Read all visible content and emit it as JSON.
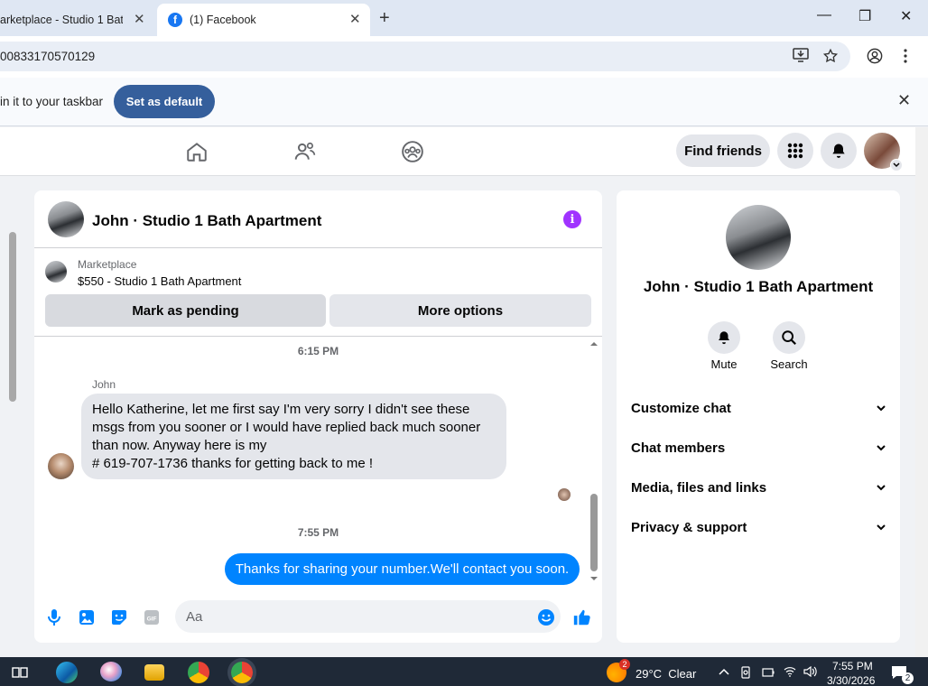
{
  "browser": {
    "tabs": [
      {
        "title": "arketplace - Studio 1 Bath",
        "close": "✕"
      },
      {
        "title": "(1) Facebook",
        "favicon": "f",
        "close": "✕"
      }
    ],
    "new_tab": "+",
    "window_controls": [
      "—",
      "❐",
      "✕"
    ],
    "url": "00833170570129",
    "infobar_message": "in it to your taskbar",
    "set_default_label": "Set as default",
    "infobar_close": "✕"
  },
  "fbnav": {
    "find_friends_label": "Find friends"
  },
  "chat": {
    "title": "John · Studio 1 Bath Apartment",
    "info_icon": "i",
    "marketplace_label": "Marketplace",
    "listing": "$550 - Studio 1 Bath Apartment",
    "mark_pending_label": "Mark as pending",
    "more_options_label": "More options",
    "messages": [
      {
        "time": "6:15 PM"
      },
      {
        "sender": "John",
        "lines": [
          "Hello Katherine, let me first say I'm very sorry I didn't see these",
          "msgs from you sooner or I would have replied back much sooner",
          "than now. Anyway here is my",
          "# 619-707-1736 thanks for getting back to me !"
        ]
      },
      {
        "time": "7:55 PM"
      },
      {
        "text": "Thanks for sharing your number.We'll contact you soon."
      }
    ],
    "composer_placeholder": "Aa",
    "gif_label": "GIF"
  },
  "side": {
    "title": "John · Studio 1 Bath Apartment",
    "mute_label": "Mute",
    "search_label": "Search",
    "sections": [
      "Customize chat",
      "Chat members",
      "Media, files and links",
      "Privacy & support"
    ],
    "section_chevron": "⌄"
  },
  "taskbar": {
    "weather_badge": "2",
    "weather": "29°C  Clear",
    "time": "7:55 PM",
    "date": "3/30/2026",
    "notif_count": "2"
  },
  "colors": {
    "accent": "#0084ff",
    "fb_blue": "#1877f2",
    "info_purple": "#a033ff",
    "set_default": "#355f9c"
  }
}
